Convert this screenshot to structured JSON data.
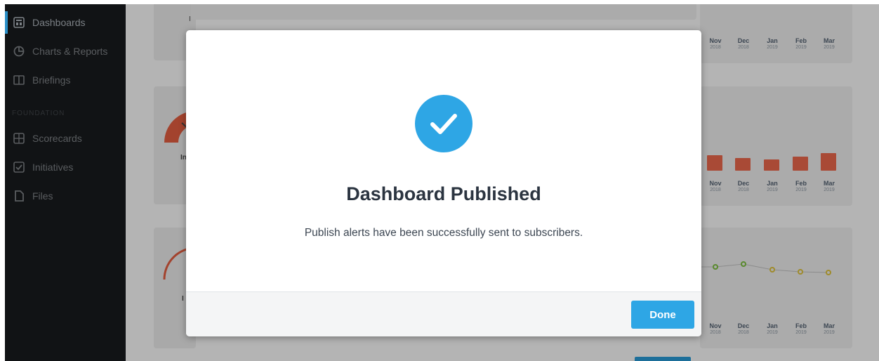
{
  "sidebar": {
    "items": [
      {
        "label": "Dashboards",
        "icon": "dashboard-icon",
        "active": true
      },
      {
        "label": "Charts & Reports",
        "icon": "pie-chart-icon"
      },
      {
        "label": "Briefings",
        "icon": "book-icon"
      },
      {
        "label": "Scorecards",
        "icon": "scorecard-icon"
      },
      {
        "label": "Initiatives",
        "icon": "checkbox-icon"
      },
      {
        "label": "Files",
        "icon": "file-icon"
      }
    ],
    "section_label": "FOUNDATION"
  },
  "background_charts": {
    "months": [
      {
        "m": "Nov",
        "y": "2018"
      },
      {
        "m": "Dec",
        "y": "2018"
      },
      {
        "m": "Jan",
        "y": "2019"
      },
      {
        "m": "Feb",
        "y": "2019"
      },
      {
        "m": "Mar",
        "y": "2019"
      }
    ],
    "gauge_labels": [
      "I",
      "In",
      "I"
    ]
  },
  "modal": {
    "title": "Dashboard Published",
    "message": "Publish alerts have been successfully sent to subscribers.",
    "done_label": "Done",
    "icon": "check-circle-icon",
    "accent_color": "#2ea6e5"
  }
}
